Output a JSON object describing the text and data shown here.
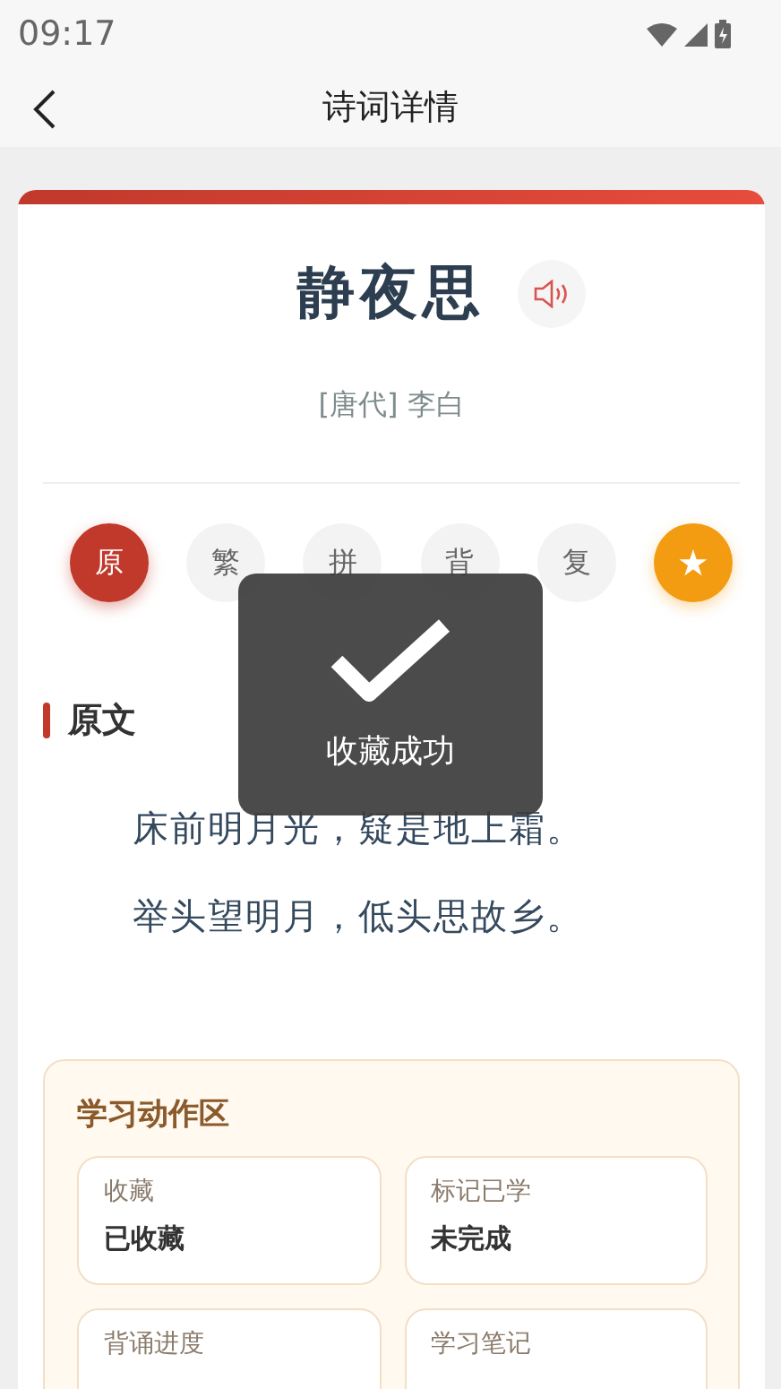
{
  "status_bar": {
    "time": "09:17"
  },
  "header": {
    "title": "诗词详情"
  },
  "poem": {
    "title": "静夜思",
    "dynasty": "[唐代]",
    "author": "李白"
  },
  "modes": [
    {
      "kind": "mode",
      "label": "原",
      "selected": true
    },
    {
      "kind": "mode",
      "label": "繁",
      "selected": false
    },
    {
      "kind": "mode",
      "label": "拼",
      "selected": false
    },
    {
      "kind": "mode",
      "label": "背",
      "selected": false
    },
    {
      "kind": "mode",
      "label": "复",
      "selected": false
    },
    {
      "kind": "favorite",
      "label": "★",
      "on": true
    }
  ],
  "section": {
    "title": "原文",
    "lines": [
      "床前明月光，疑是地上霜。",
      "举头望明月，低头思故乡。"
    ]
  },
  "study": {
    "title": "学习动作区",
    "cards": [
      {
        "label": "收藏",
        "value": "已收藏"
      },
      {
        "label": "标记已学",
        "value": "未完成"
      },
      {
        "label": "背诵进度"
      },
      {
        "label": "学习笔记"
      }
    ]
  },
  "toast": {
    "message": "收藏成功"
  }
}
